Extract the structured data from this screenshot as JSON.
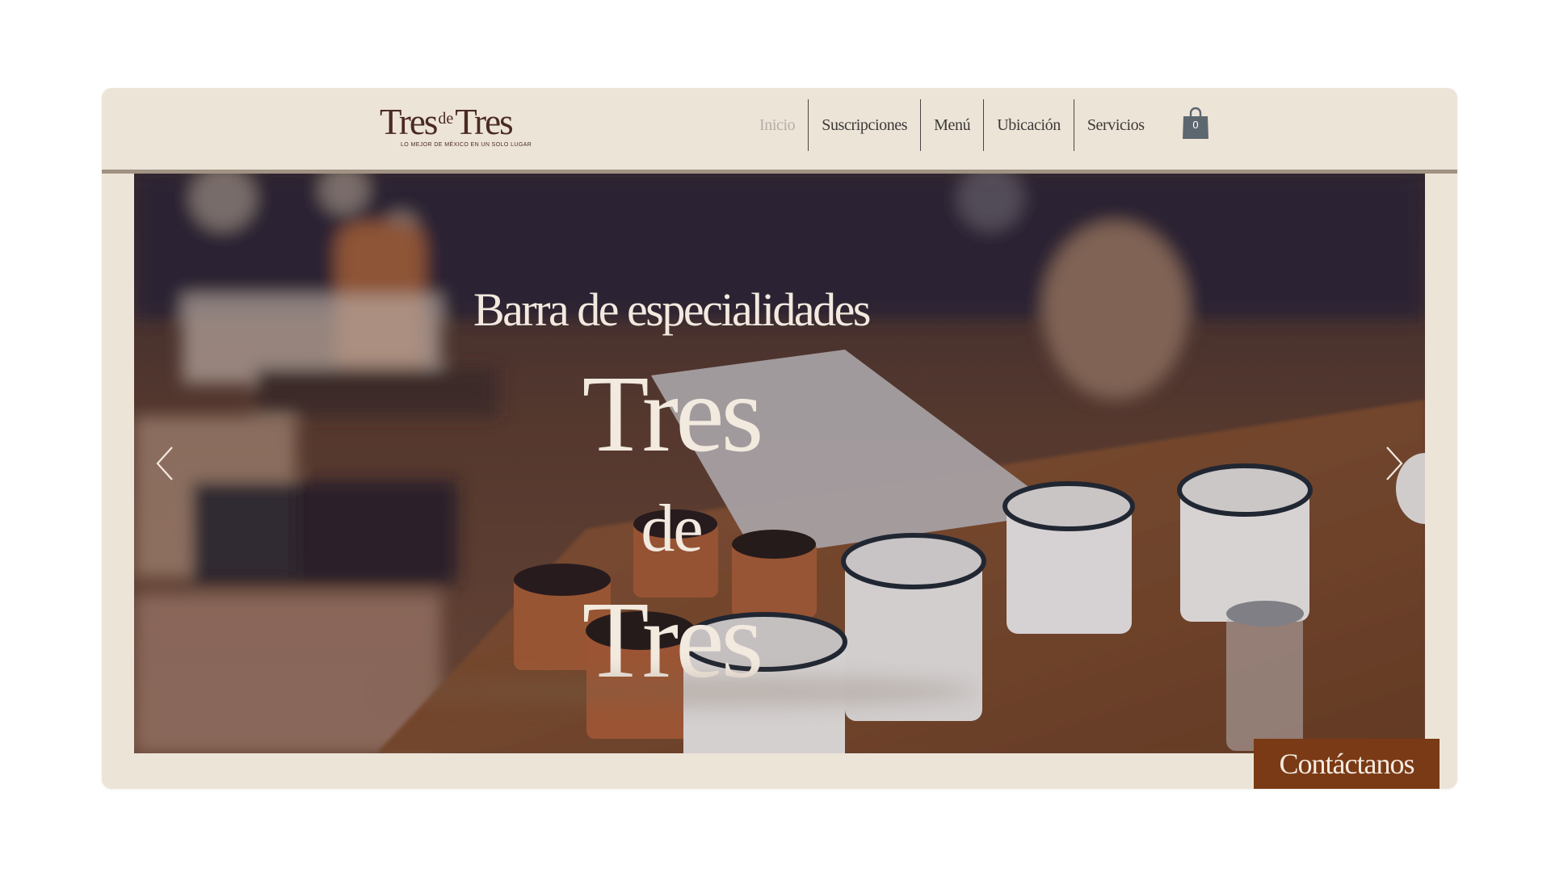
{
  "brand": {
    "logo_word_1": "Tres",
    "logo_word_2": "de",
    "logo_word_3": "Tres",
    "tagline": "LO MEJOR DE MÉXICO EN UN SOLO LUGAR",
    "text_color": "#4a2a22"
  },
  "nav": {
    "items": [
      {
        "label": "Inicio",
        "active": true
      },
      {
        "label": "Suscripciones",
        "active": false
      },
      {
        "label": "Menú",
        "active": false
      },
      {
        "label": "Ubicación",
        "active": false
      },
      {
        "label": "Servicios",
        "active": false
      }
    ]
  },
  "cart": {
    "count": "0",
    "icon": "shopping-bag-icon",
    "color": "#5d6770"
  },
  "hero": {
    "headline": "Barra de especialidades",
    "word_1": "Tres",
    "word_2": "de",
    "word_3": "Tres",
    "prev_icon": "chevron-left-icon",
    "next_icon": "chevron-right-icon"
  },
  "contact": {
    "label": "Contáctanos",
    "color": "#7a3a16"
  },
  "colors": {
    "page_background": "#ffffff",
    "site_background": "#ede4d8",
    "header_rule": "#a09383",
    "hero_text": "#f2e9df"
  }
}
